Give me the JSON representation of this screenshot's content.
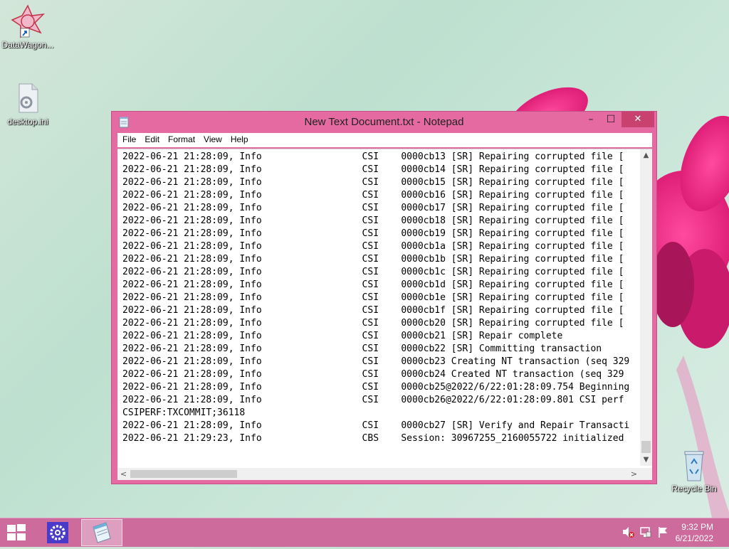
{
  "desktop": {
    "icons": [
      {
        "label": "DataWagon...",
        "icon": "datawagon-shortcut-icon"
      },
      {
        "label": "desktop.ini",
        "icon": "config-file-icon"
      },
      {
        "label": "Recycle Bin",
        "icon": "recycle-bin-icon"
      }
    ]
  },
  "window": {
    "title": "New Text Document.txt - Notepad",
    "accent_color": "#e56aa2",
    "close_color": "#c9416f",
    "controls": {
      "minimize": "–",
      "maximize": "☐",
      "close": "✕"
    },
    "menu": [
      "File",
      "Edit",
      "Format",
      "View",
      "Help"
    ],
    "lines": [
      "2022-06-21 21:28:09, Info                  CSI    0000cb13 [SR] Repairing corrupted file [",
      "2022-06-21 21:28:09, Info                  CSI    0000cb14 [SR] Repairing corrupted file [",
      "2022-06-21 21:28:09, Info                  CSI    0000cb15 [SR] Repairing corrupted file [",
      "2022-06-21 21:28:09, Info                  CSI    0000cb16 [SR] Repairing corrupted file [",
      "2022-06-21 21:28:09, Info                  CSI    0000cb17 [SR] Repairing corrupted file [",
      "2022-06-21 21:28:09, Info                  CSI    0000cb18 [SR] Repairing corrupted file [",
      "2022-06-21 21:28:09, Info                  CSI    0000cb19 [SR] Repairing corrupted file [",
      "2022-06-21 21:28:09, Info                  CSI    0000cb1a [SR] Repairing corrupted file [",
      "2022-06-21 21:28:09, Info                  CSI    0000cb1b [SR] Repairing corrupted file [",
      "2022-06-21 21:28:09, Info                  CSI    0000cb1c [SR] Repairing corrupted file [",
      "2022-06-21 21:28:09, Info                  CSI    0000cb1d [SR] Repairing corrupted file [",
      "2022-06-21 21:28:09, Info                  CSI    0000cb1e [SR] Repairing corrupted file [",
      "2022-06-21 21:28:09, Info                  CSI    0000cb1f [SR] Repairing corrupted file [",
      "2022-06-21 21:28:09, Info                  CSI    0000cb20 [SR] Repairing corrupted file [",
      "2022-06-21 21:28:09, Info                  CSI    0000cb21 [SR] Repair complete",
      "2022-06-21 21:28:09, Info                  CSI    0000cb22 [SR] Committing transaction",
      "2022-06-21 21:28:09, Info                  CSI    0000cb23 Creating NT transaction (seq 329",
      "2022-06-21 21:28:09, Info                  CSI    0000cb24 Created NT transaction (seq 329",
      "2022-06-21 21:28:09, Info                  CSI    0000cb25@2022/6/22:01:28:09.754 Beginning",
      "2022-06-21 21:28:09, Info                  CSI    0000cb26@2022/6/22:01:28:09.801 CSI perf",
      "CSIPERF:TXCOMMIT;36118",
      "2022-06-21 21:28:09, Info                  CSI    0000cb27 [SR] Verify and Repair Transacti",
      "2022-06-21 21:29:23, Info                  CBS    Session: 30967255_2160055722 initialized"
    ],
    "scrollbar_arrows": {
      "up": "▲",
      "down": "▼",
      "left": "<",
      "right": ">"
    }
  },
  "taskbar": {
    "color": "#cd6b9d",
    "items": [
      {
        "name": "start-button",
        "icon": "windows-logo-icon"
      },
      {
        "name": "settings",
        "icon": "gear-icon"
      },
      {
        "name": "notepad",
        "icon": "notepad-icon",
        "active": true
      }
    ],
    "tray": [
      "volume-muted-icon",
      "network-icon",
      "action-center-flag-icon"
    ],
    "time": "9:32 PM",
    "date": "6/21/2022"
  }
}
